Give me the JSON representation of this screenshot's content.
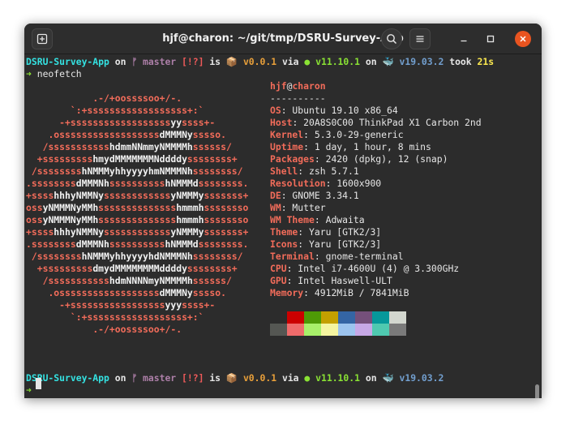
{
  "window": {
    "title": "hjf@charon: ~/git/tmp/DSRU-Survey-App",
    "controls": [
      "new-tab-icon",
      "search-icon",
      "hamburger-menu-icon",
      "minimize-icon",
      "maximize-icon",
      "close-icon"
    ]
  },
  "prompt1": {
    "dir": "DSRU-Survey-App",
    "on1": " on ",
    "git_icon": "ᚠ",
    "branch": " master",
    "status": " [!?]",
    "is": " is ",
    "pkg_icon": "📦",
    "pkg_version": " v0.0.1",
    "via": " via ",
    "node_icon": "●",
    "node_version": " v11.10.1",
    "on2": " on ",
    "docker_icon": "🐳",
    "docker_version": " v19.03.2",
    "took": " took ",
    "duration": "21s"
  },
  "command": {
    "arrow": "➜",
    "text": " neofetch"
  },
  "logo": [
    "            .-/+oossssoo+/-.",
    "        `:+ssssssssssssssssss+:`",
    "      -+ssssssssssssssssssyyssss+-",
    "    .ossssssssssssssssssdMMMNysssso.",
    "   /ssssssssssshdmmNNmmyNMMMMhssssss/",
    "  +ssssssssshmydMMMMMMMNddddyssssssss+",
    " /sssssssshNMMMyhhyyyyhmNMMMNhssssssss/",
    ".ssssssssdMMMNhsssssssssshNMMMdssssssss.",
    "+sssshhhyNMMNyssssssssssssyNMMMysssssss+",
    "ossyNMMMNyMMhsssssssssssssshmmmhssssssso",
    "ossyNMMMNyMMhsssssssssssssshmmmhssssssso",
    "+sssshhhyNMMNyssssssssssssyNMMMysssssss+",
    ".ssssssssdMMMNhsssssssssshNMMMdssssssss.",
    " /sssssssshNMMMyhhyyyyhdNMMMNhssssssss/",
    "  +sssssssssdmydMMMMMMMMddddyssssssss+",
    "   /ssssssssssshdmNNNNmyNMMMMhssssss/",
    "    .ossssssssssssssssssdMMMNysssso.",
    "      -+sssssssssssssssssyyyssss+-",
    "        `:+ssssssssssssssssss+:`",
    "            .-/+oossssoo+/-."
  ],
  "info": {
    "user": "hjf",
    "at": "@",
    "host": "charon",
    "separator": "----------",
    "rows": [
      {
        "key": "OS",
        "value": "Ubuntu 19.10 x86_64"
      },
      {
        "key": "Host",
        "value": "20A8S0C00 ThinkPad X1 Carbon 2nd"
      },
      {
        "key": "Kernel",
        "value": "5.3.0-29-generic"
      },
      {
        "key": "Uptime",
        "value": "1 day, 1 hour, 8 mins"
      },
      {
        "key": "Packages",
        "value": "2420 (dpkg), 12 (snap)"
      },
      {
        "key": "Shell",
        "value": "zsh 5.7.1"
      },
      {
        "key": "Resolution",
        "value": "1600x900"
      },
      {
        "key": "DE",
        "value": "GNOME 3.34.1"
      },
      {
        "key": "WM",
        "value": "Mutter"
      },
      {
        "key": "WM Theme",
        "value": "Adwaita"
      },
      {
        "key": "Theme",
        "value": "Yaru [GTK2/3]"
      },
      {
        "key": "Icons",
        "value": "Yaru [GTK2/3]"
      },
      {
        "key": "Terminal",
        "value": "gnome-terminal"
      },
      {
        "key": "CPU",
        "value": "Intel i7-4600U (4) @ 3.300GHz"
      },
      {
        "key": "GPU",
        "value": "Intel Haswell-ULT"
      },
      {
        "key": "Memory",
        "value": "4912MiB / 7841MiB"
      }
    ],
    "key_suffix": ": "
  },
  "palette": {
    "top": [
      "#2c2c2c",
      "#cc0000",
      "#4e9a06",
      "#c4a000",
      "#3465a4",
      "#75507b",
      "#06989a",
      "#d3d7cf"
    ],
    "bottom": [
      "#555753",
      "#ef6b6b",
      "#a8f06a",
      "#f5f5a0",
      "#9cc4ee",
      "#c7a8e6",
      "#4fc9b0",
      "#7a7a7a"
    ]
  },
  "prompt2": {
    "dir": "DSRU-Survey-App",
    "on1": " on ",
    "git_icon": "ᚠ",
    "branch": " master",
    "status": " [!?]",
    "is": " is ",
    "pkg_icon": "📦",
    "pkg_version": " v0.0.1",
    "via": " via ",
    "node_icon": "●",
    "node_version": " v11.10.1",
    "on2": " on ",
    "docker_icon": "🐳",
    "docker_version": " v19.03.2"
  },
  "prompt3": {
    "arrow": "➜"
  }
}
